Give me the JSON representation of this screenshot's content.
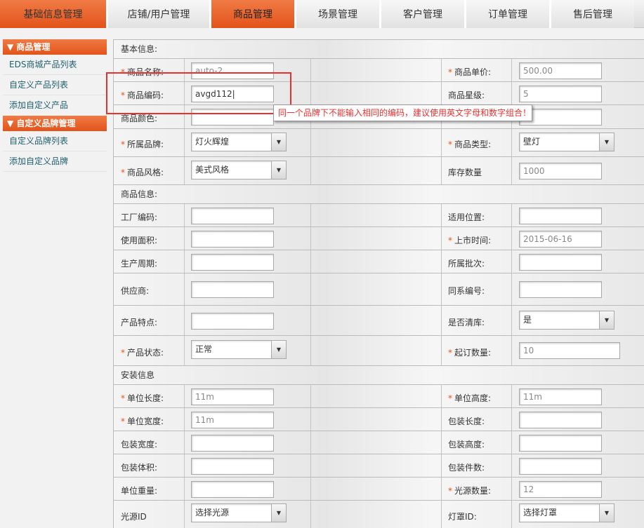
{
  "topnav": {
    "tabs": [
      {
        "label": "基础信息管理",
        "active": true
      },
      {
        "label": "店铺/用户管理",
        "active": false
      },
      {
        "label": "商品管理",
        "active": true
      },
      {
        "label": "场景管理",
        "active": false
      },
      {
        "label": "客户管理",
        "active": false
      },
      {
        "label": "订单管理",
        "active": false
      },
      {
        "label": "售后管理",
        "active": false
      }
    ]
  },
  "sidebar": {
    "group1": "▼ 商品管理",
    "group1_items": [
      "EDS商城产品列表",
      "自定义产品列表",
      "添加自定义产品"
    ],
    "group2": "▼ 自定义品牌管理",
    "group2_items": [
      "自定义品牌列表",
      "添加自定义品牌"
    ]
  },
  "sections": {
    "basic": "基本信息:",
    "product": "商品信息:",
    "install": "安装信息"
  },
  "form": {
    "name_label": "商品名称:",
    "name_value": "auto-2",
    "price_label": "商品单价:",
    "price_value": "500.00",
    "code_label": "商品编码:",
    "code_value": "avgd112",
    "star_label": "商品星级:",
    "star_value": "5",
    "color_label": "商品颜色:",
    "brand_label": "所属品牌:",
    "brand_value": "灯火辉煌",
    "type_label": "商品类型:",
    "type_value": "壁灯",
    "style_label": "商品风格:",
    "style_value": "美式风格",
    "stock_label": "库存数量",
    "stock_value": "1000",
    "factory_label": "工厂编码:",
    "position_label": "适用位置:",
    "area_label": "使用面积:",
    "launch_label": "上市时间:",
    "launch_value": "2015-06-16",
    "cycle_label": "生产周期:",
    "batch_label": "所属批次:",
    "supplier_label": "供应商:",
    "series_label": "同系编号:",
    "feature_label": "产品特点:",
    "clearance_label": "是否清库:",
    "clearance_value": "是",
    "status_label": "产品状态:",
    "status_value": "正常",
    "min_order_label": "起订数量:",
    "min_order_value": "10",
    "unit_length_label": "单位长度:",
    "unit_length_value": "11m",
    "unit_height_label": "单位高度:",
    "unit_height_value": "11m",
    "unit_width_label": "单位宽度:",
    "unit_width_value": "11m",
    "pack_length_label": "包装长度:",
    "pack_width_label": "包装宽度:",
    "pack_height_label": "包装高度:",
    "pack_volume_label": "包装体积:",
    "pack_count_label": "包装件数:",
    "unit_weight_label": "单位重量:",
    "light_count_label": "光源数量:",
    "light_count_value": "12",
    "light_id_label": "光源ID",
    "light_id_value": "选择光源",
    "lamp_id_label": "灯罩ID:",
    "lamp_id_value": "选择灯罩"
  },
  "tooltip": "同一个品牌下不能输入相同的编码，建议使用英文字母和数字组合！",
  "colors": {
    "accent": "#e2541a",
    "error": "#e8312f"
  }
}
